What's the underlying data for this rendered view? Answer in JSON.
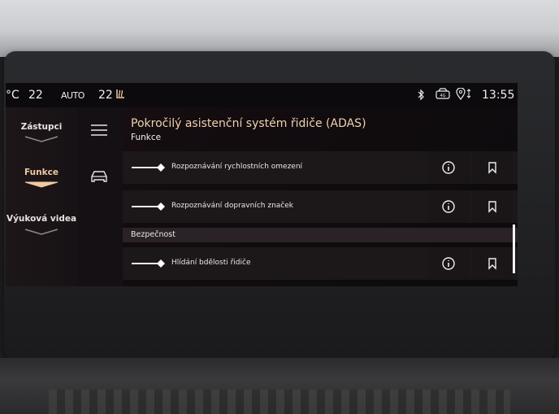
{
  "status_bar": {
    "temp_unit": "°C",
    "left_temp": "22",
    "auto": "AUTO",
    "right_temp": "22",
    "time": "13:55",
    "icons": [
      "seat-heat-icon",
      "bluetooth-icon",
      "car-4g-icon",
      "location-icon"
    ]
  },
  "sidebar": {
    "items": [
      {
        "label": "Zástupci",
        "active": false
      },
      {
        "label": "Funkce",
        "active": true
      },
      {
        "label": "Výuková videa",
        "active": false
      }
    ]
  },
  "nav": {
    "icons": [
      "menu-icon",
      "car-icon"
    ]
  },
  "main": {
    "title": "Pokročilý asistenční systém řidiče (ADAS)",
    "subtitle": "Funkce",
    "rows": [
      {
        "label": "Rozpoznávání rychlostních omezení",
        "toggle": "on"
      },
      {
        "label": "Rozpoznávání dopravních značek",
        "toggle": "on"
      }
    ],
    "section": "Bezpečnost",
    "section_rows": [
      {
        "label": "Hlídání bdělosti řidiče",
        "toggle": "on"
      }
    ]
  },
  "colors": {
    "accent": "#f0c9a0",
    "title": "#f0d1b0",
    "background": "#120c0f"
  }
}
